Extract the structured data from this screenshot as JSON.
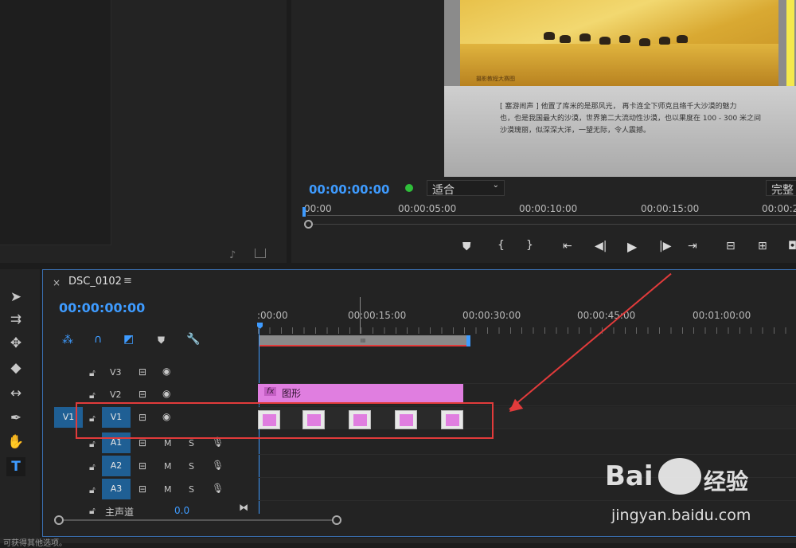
{
  "program_monitor": {
    "timecode": "00:00:00:00",
    "fit_option": "适合",
    "quality_option": "完整",
    "ruler": [
      "00:00",
      "00:00:05:00",
      "00:00:10:00",
      "00:00:15:00",
      "00:00:2"
    ],
    "photo_caption": "摄影教程大赛图",
    "page_line1": "[ 塞游闹声 ] 他置了库米的是那风光， 再卡连全下师克且络千大沙漠的魅力",
    "page_line2": "也，也是我国最大的沙漠，世界第二大流动性沙漠，也以果度在 100 - 300 米之间",
    "page_line3": "沙漠瑰丽，似深深大洋，一望无际，令人震撼。",
    "controls": [
      "marker-icon",
      "mark-in-icon",
      "mark-out-icon",
      "go-to-in-icon",
      "step-back-icon",
      "play-icon",
      "step-forward-icon",
      "go-to-out-icon",
      "lift-icon",
      "extract-icon",
      "export-frame-icon"
    ]
  },
  "source_panel": {
    "icons": [
      "insert-audio-icon",
      "export-icon"
    ]
  },
  "tools": [
    "selection-tool-icon",
    "track-select-tool-icon",
    "ripple-edit-tool-icon",
    "razor-tool-icon",
    "slip-tool-icon",
    "pen-tool-icon",
    "hand-tool-icon",
    "type-tool-icon"
  ],
  "timeline": {
    "close_label": "×",
    "sequence_name": "DSC_0102",
    "menu_label": "≡",
    "timecode": "00:00:00:00",
    "ruler": [
      ":00:00",
      "00:00:15:00",
      "00:00:30:00",
      "00:00:45:00",
      "00:01:00:00"
    ],
    "work_area_label": "III",
    "tracks": {
      "v3": "V3",
      "v2": "V2",
      "v1": "V1",
      "v1_source": "V1",
      "a1": "A1",
      "a2": "A2",
      "a3": "A3",
      "mute": "M",
      "solo": "S",
      "master_label": "主声道",
      "master_value": "0.0"
    },
    "graphic_clip": {
      "fx": "fx",
      "name": "图形"
    }
  },
  "status_text": "可获得其他选项。",
  "watermark": {
    "brand": "Bai",
    "brand_cn": "经验",
    "url": "jingyan.baidu.com"
  },
  "colors": {
    "accent": "#3e9bff",
    "clip_pink": "#e07ee0",
    "track_blue": "#1f5f94",
    "annotation_red": "#e23b3b"
  }
}
